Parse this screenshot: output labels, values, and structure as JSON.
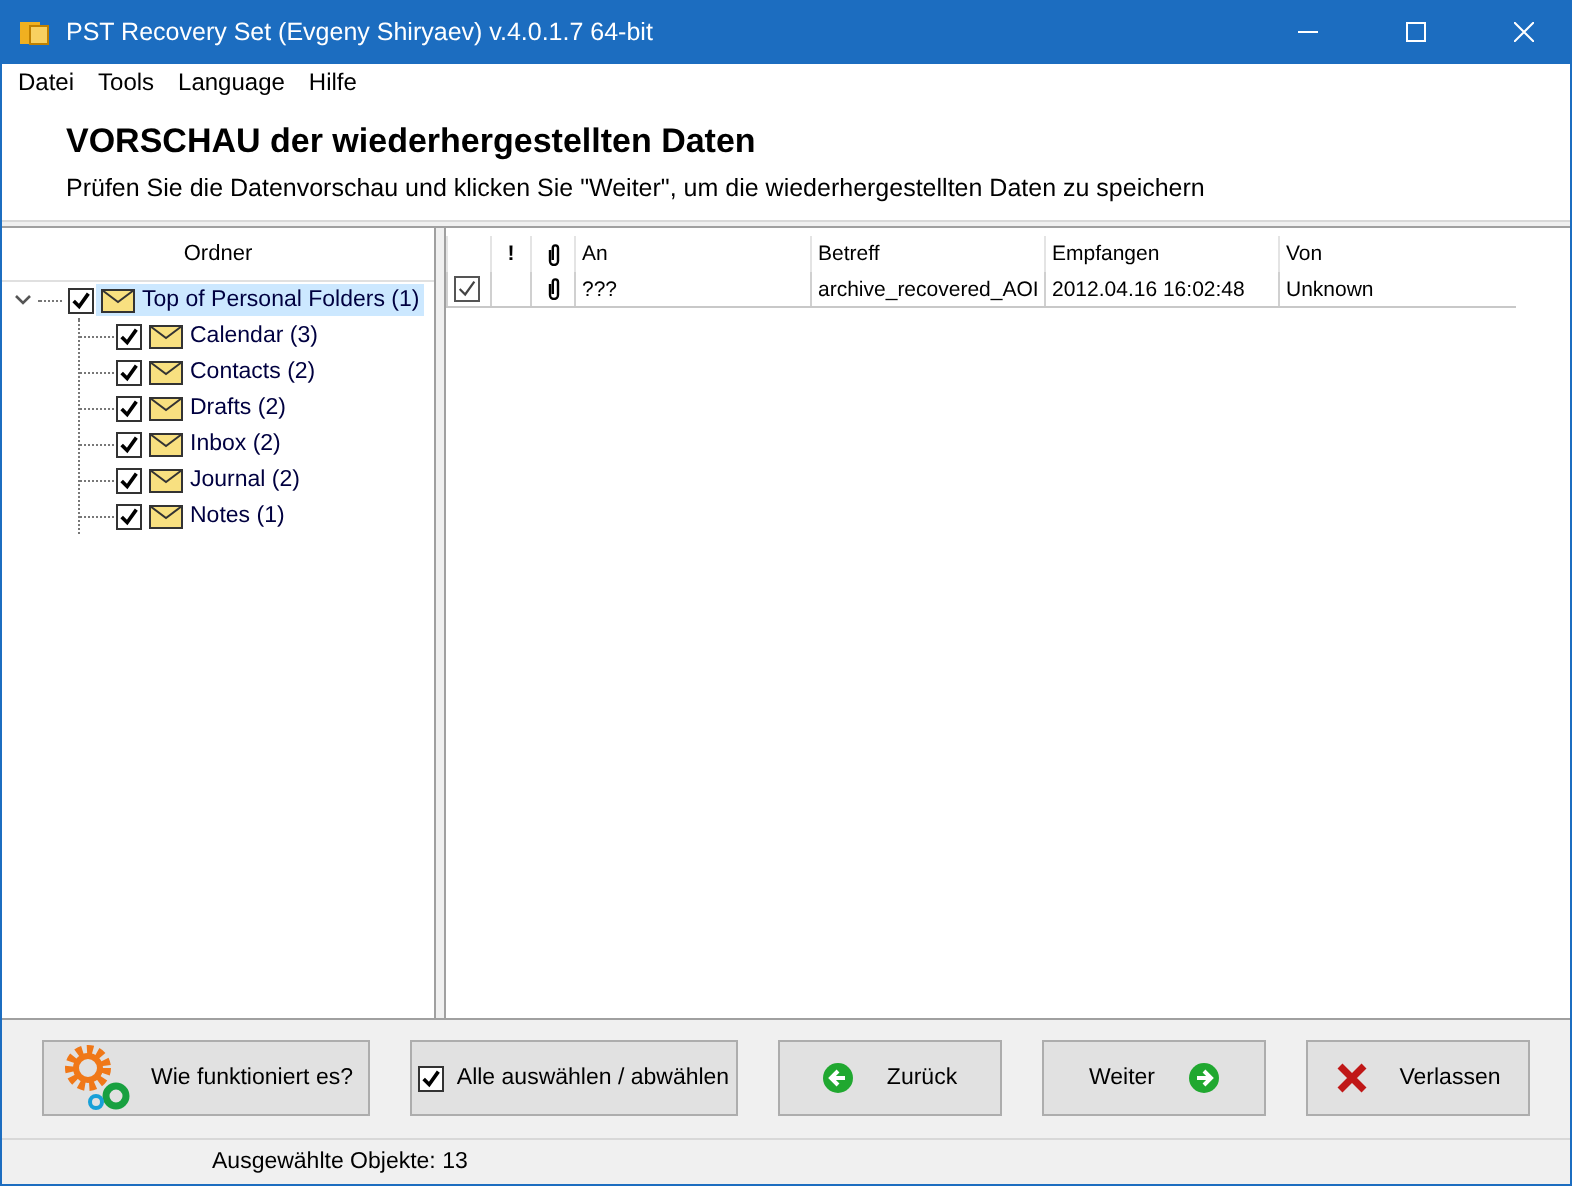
{
  "window": {
    "title": "PST Recovery Set (Evgeny Shiryaev) v.4.0.1.7 64-bit"
  },
  "menu": [
    "Datei",
    "Tools",
    "Language",
    "Hilfe"
  ],
  "header": {
    "title": "VORSCHAU der wiederhergestellten Daten",
    "subtitle": "Prüfen Sie die Datenvorschau und klicken Sie \"Weiter\", um die wiederhergestellten Daten zu speichern"
  },
  "tree": {
    "heading": "Ordner",
    "items": [
      {
        "label": "Top of Personal Folders (1)",
        "checked": true,
        "selected": true,
        "expanded": true,
        "children": [
          {
            "label": "Calendar (3)",
            "checked": true,
            "selected": false
          },
          {
            "label": "Contacts (2)",
            "checked": true,
            "selected": false
          },
          {
            "label": "Drafts (2)",
            "checked": true,
            "selected": false
          },
          {
            "label": "Inbox (2)",
            "checked": true,
            "selected": false
          },
          {
            "label": "Journal (2)",
            "checked": true,
            "selected": false
          },
          {
            "label": "Notes (1)",
            "checked": true,
            "selected": false
          }
        ]
      }
    ]
  },
  "table": {
    "columns": [
      "!",
      "An",
      "Betreff",
      "Empfangen",
      "Von"
    ],
    "rows": [
      {
        "checked": true,
        "attachment": true,
        "an": "???",
        "betreff": "archive_recovered_AOI",
        "empfangen": "2012.04.16 16:02:48",
        "von": "Unknown"
      }
    ]
  },
  "buttons": [
    {
      "kind": "help",
      "label": "Wie funktioniert es?"
    },
    {
      "kind": "toggle",
      "label": "Alle auswählen / abwählen",
      "checked": true
    },
    {
      "kind": "back",
      "label": "Zurück"
    },
    {
      "kind": "next",
      "label": "Weiter"
    },
    {
      "kind": "exit",
      "label": "Verlassen"
    }
  ],
  "status_bar": "Ausgewählte Objekte: 13"
}
